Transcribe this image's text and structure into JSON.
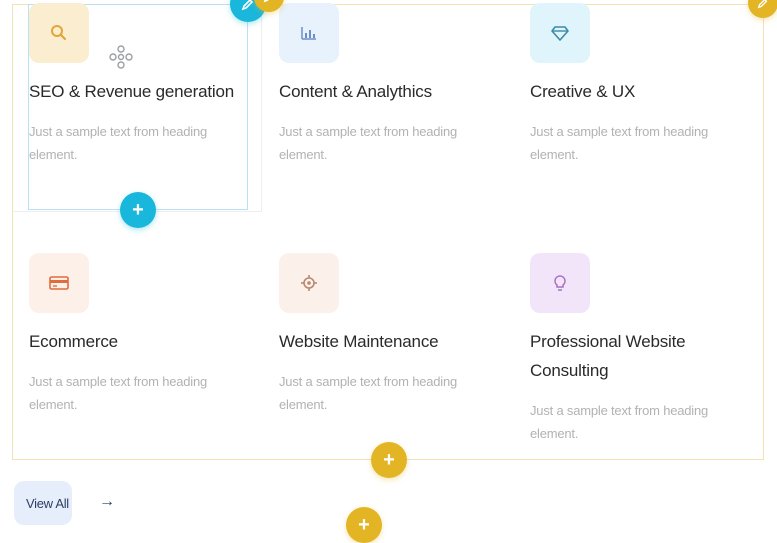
{
  "services": [
    {
      "title": "SEO & Revenue generation",
      "description": "Just a sample text from heading element.",
      "icon": "search-icon",
      "icon_bg": "#fbeed0",
      "icon_color": "#e3a53a"
    },
    {
      "title": "Content & Analythics",
      "description": "Just a sample text from heading element.",
      "icon": "chart-icon",
      "icon_bg": "#e8f2fd",
      "icon_color": "#6d8fc6"
    },
    {
      "title": "Creative & UX",
      "description": "Just a sample text from heading element.",
      "icon": "diamond-icon",
      "icon_bg": "#dff4fb",
      "icon_color": "#3d8aa6"
    },
    {
      "title": "Ecommerce",
      "description": "Just a sample text from heading element.",
      "icon": "credit-card-icon",
      "icon_bg": "#fdf0e8",
      "icon_color": "#e06b3c"
    },
    {
      "title": "Website Maintenance",
      "description": "Just a sample text from heading element.",
      "icon": "gear-icon",
      "icon_bg": "#fbf1ea",
      "icon_color": "#b88970"
    },
    {
      "title": "Professional Website Consulting",
      "description": "Just a sample text from heading element.",
      "icon": "lightbulb-icon",
      "icon_bg": "#f2e4f9",
      "icon_color": "#a86fc2"
    }
  ],
  "view_all": {
    "label": "View All",
    "arrow": "→"
  },
  "editor": {
    "add_symbol": "+",
    "edit_icon": "pencil-icon",
    "accent_blue": "#19b7dc",
    "accent_gold": "#e3b524"
  }
}
